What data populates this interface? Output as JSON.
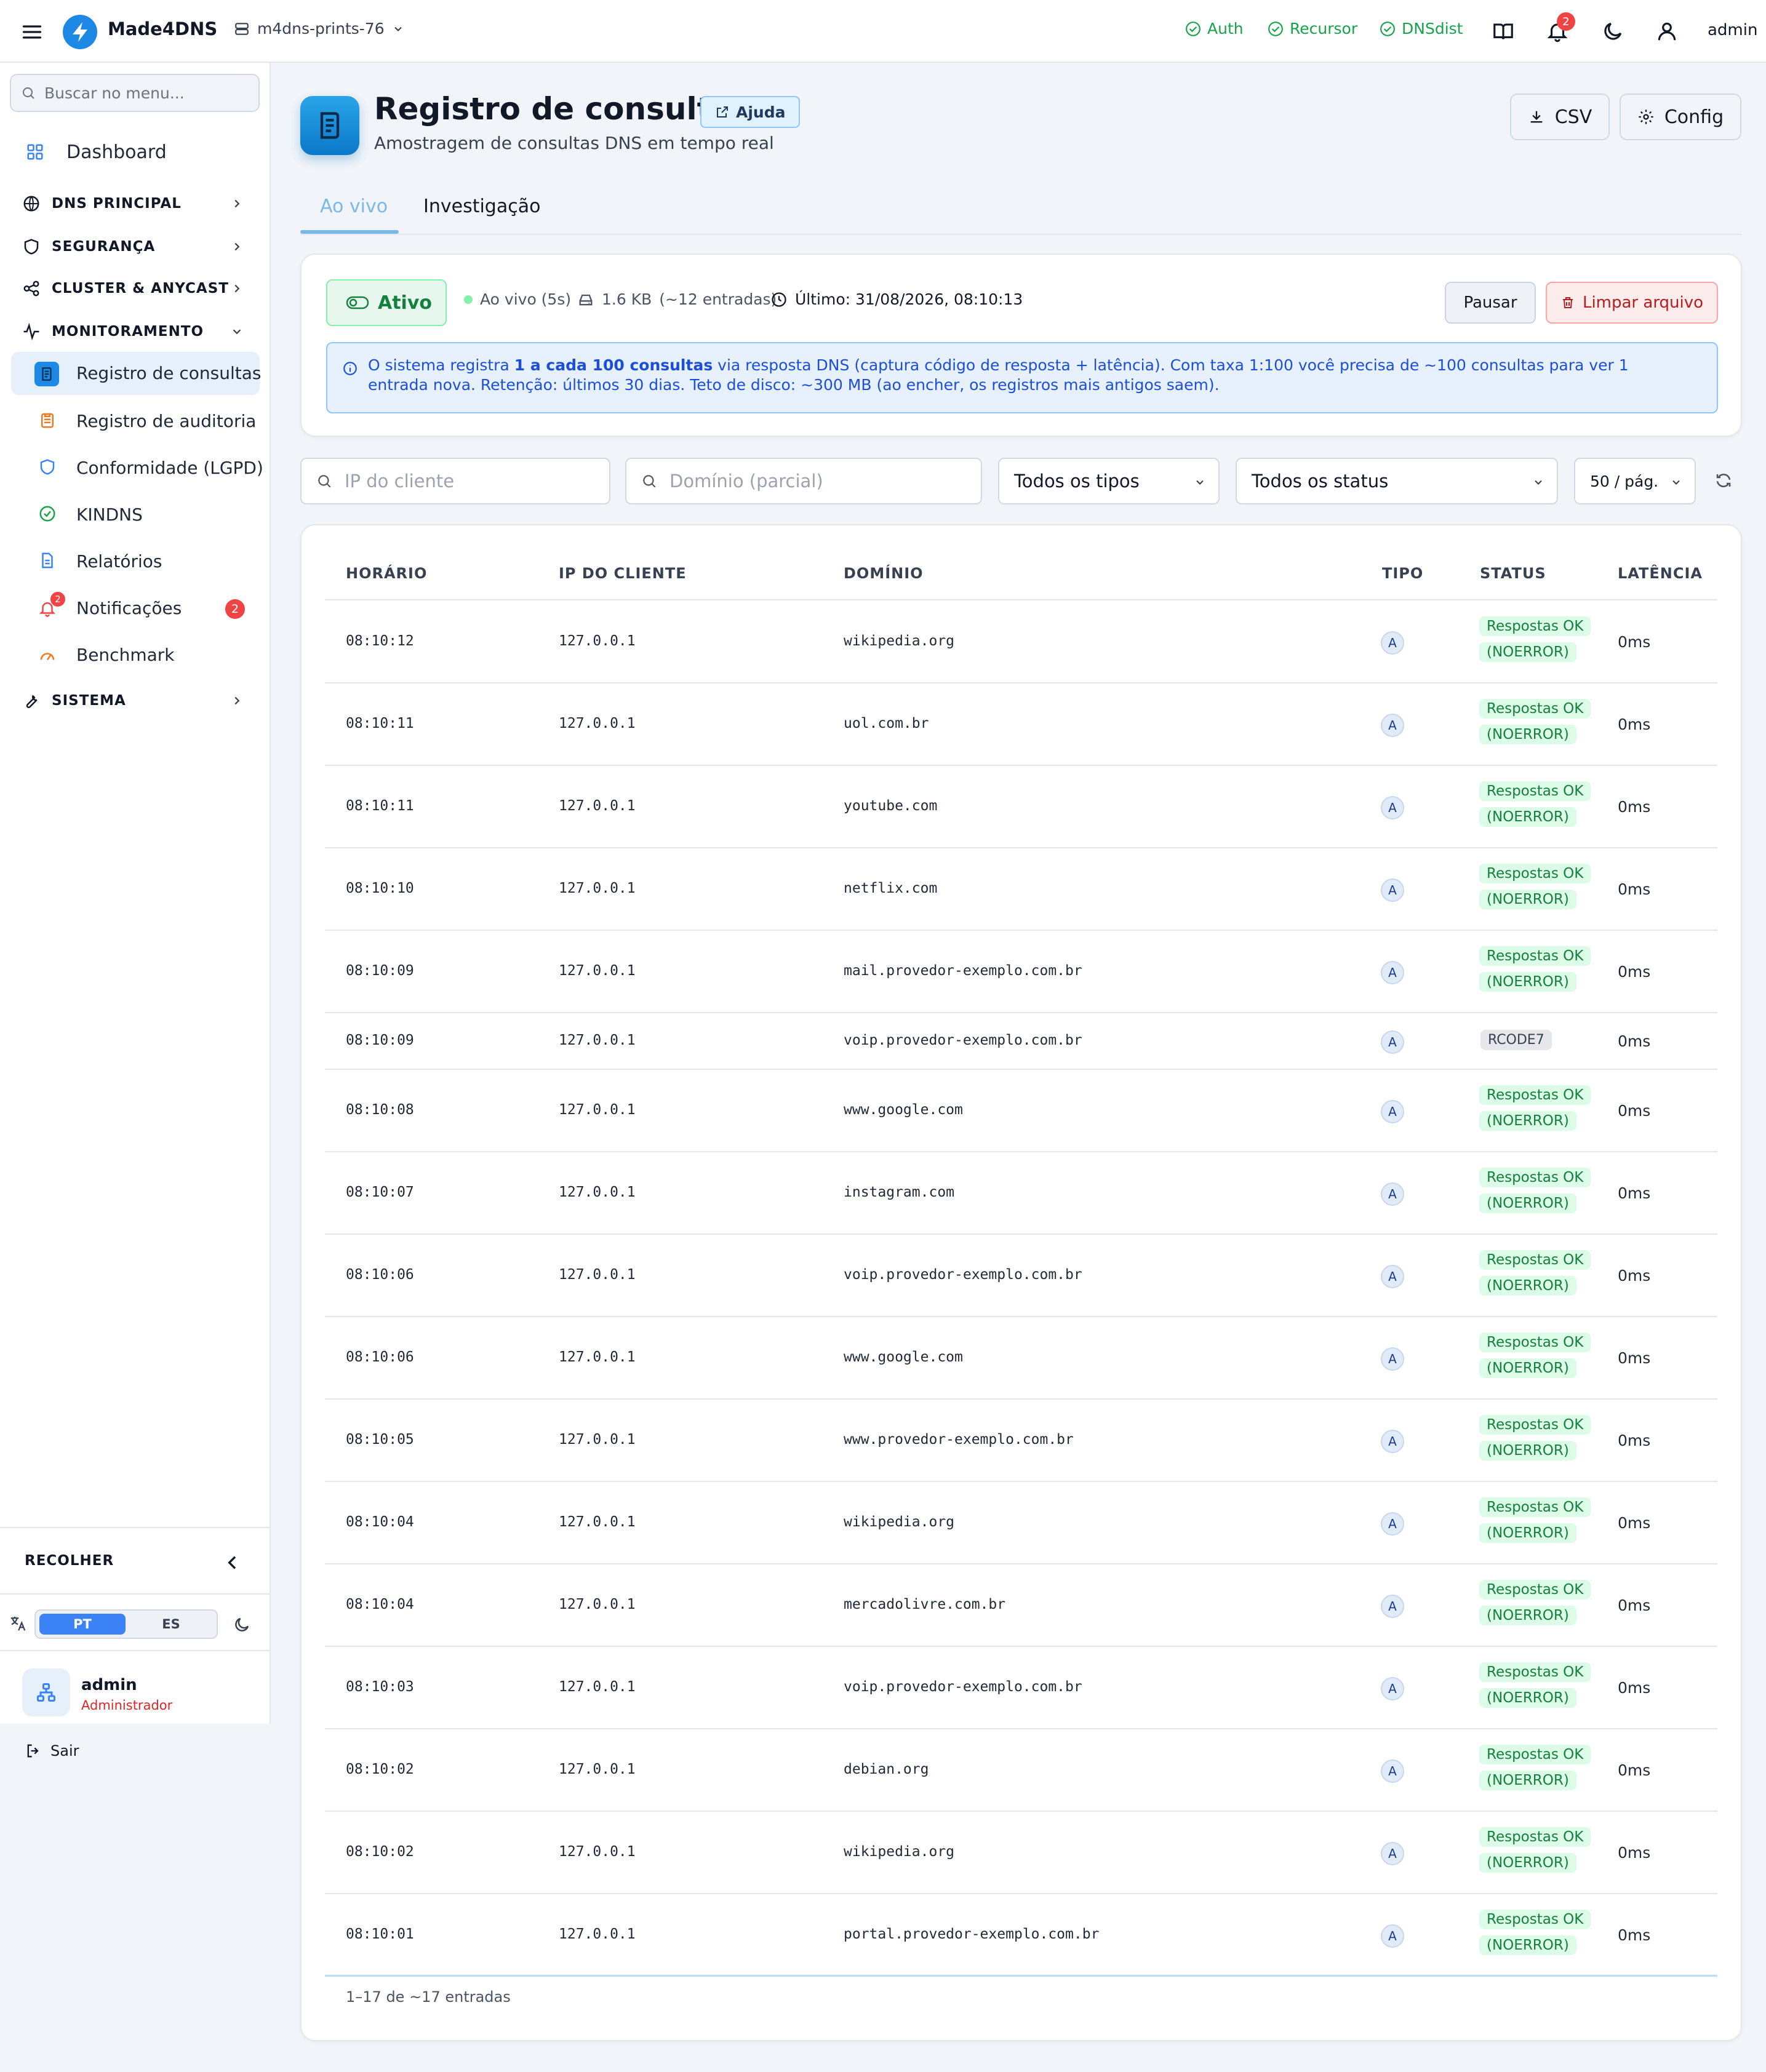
{
  "topbar": {
    "brand": "Made4DNS",
    "server": "m4dns-prints-76",
    "services": [
      "Auth",
      "Recursor",
      "DNSdist"
    ],
    "notifications_count": "2",
    "user": "admin"
  },
  "sidebar": {
    "search_placeholder": "Buscar no menu...",
    "dashboard": "Dashboard",
    "sections": {
      "dns": "DNS PRINCIPAL",
      "security": "SEGURANÇA",
      "cluster": "CLUSTER & ANYCAST",
      "monitoring": "MONITORAMENTO",
      "system": "SISTEMA"
    },
    "items": [
      {
        "label": "Registro de consultas",
        "icon": "query-log-icon"
      },
      {
        "label": "Registro de auditoria",
        "icon": "clipboard-icon"
      },
      {
        "label": "Conformidade (LGPD)",
        "icon": "shield-icon"
      },
      {
        "label": "KINDNS",
        "icon": "check-circle-icon"
      },
      {
        "label": "Relatórios",
        "icon": "document-icon"
      },
      {
        "label": "Notificações",
        "icon": "bell-icon",
        "badge": "2"
      },
      {
        "label": "Benchmark",
        "icon": "gauge-icon"
      }
    ],
    "collapse": "RECOLHER",
    "lang_pt": "PT",
    "lang_es": "ES",
    "user_name": "admin",
    "user_role": "Administrador",
    "logout": "Sair"
  },
  "header": {
    "title": "Registro de consultas",
    "help": "Ajuda",
    "subtitle": "Amostragem de consultas DNS em tempo real",
    "csv": "CSV",
    "config": "Config"
  },
  "tabs": [
    "Ao vivo",
    "Investigação"
  ],
  "status": {
    "state": "Ativo",
    "live": "Ao vivo (5s)",
    "size": "1.6 KB",
    "entries": "(~12 entradas)",
    "last": "Último: 31/08/2026, 08:10:13",
    "pause": "Pausar",
    "clear": "Limpar arquivo",
    "info_pre": "O sistema registra ",
    "info_bold": "1 a cada 100 consultas",
    "info_post": " via resposta DNS (captura código de resposta + latência). Com taxa 1:100 você precisa de ~100 consultas para ver 1 entrada nova. Retenção: últimos 30 dias. Teto de disco: ~300 MB (ao encher, os registros mais antigos saem)."
  },
  "filters": {
    "ip_placeholder": "IP do cliente",
    "domain_placeholder": "Domínio (parcial)",
    "type": "Todos os tipos",
    "status": "Todos os status",
    "per_page": "50 / pág."
  },
  "table": {
    "columns": [
      "HORÁRIO",
      "IP DO CLIENTE",
      "DOMÍNIO",
      "TIPO",
      "STATUS",
      "LATÊNCIA"
    ],
    "rows": [
      {
        "time": "08:10:12",
        "ip": "127.0.0.1",
        "domain": "wikipedia.org",
        "type": "A",
        "status1": "Respostas OK",
        "status2": "(NOERROR)",
        "latency": "0ms"
      },
      {
        "time": "08:10:11",
        "ip": "127.0.0.1",
        "domain": "uol.com.br",
        "type": "A",
        "status1": "Respostas OK",
        "status2": "(NOERROR)",
        "latency": "0ms"
      },
      {
        "time": "08:10:11",
        "ip": "127.0.0.1",
        "domain": "youtube.com",
        "type": "A",
        "status1": "Respostas OK",
        "status2": "(NOERROR)",
        "latency": "0ms"
      },
      {
        "time": "08:10:10",
        "ip": "127.0.0.1",
        "domain": "netflix.com",
        "type": "A",
        "status1": "Respostas OK",
        "status2": "(NOERROR)",
        "latency": "0ms"
      },
      {
        "time": "08:10:09",
        "ip": "127.0.0.1",
        "domain": "mail.provedor-exemplo.com.br",
        "type": "A",
        "status1": "Respostas OK",
        "status2": "(NOERROR)",
        "latency": "0ms"
      },
      {
        "time": "08:10:09",
        "ip": "127.0.0.1",
        "domain": "voip.provedor-exemplo.com.br",
        "type": "A",
        "status1": "RCODE7",
        "status2": "",
        "latency": "0ms"
      },
      {
        "time": "08:10:08",
        "ip": "127.0.0.1",
        "domain": "www.google.com",
        "type": "A",
        "status1": "Respostas OK",
        "status2": "(NOERROR)",
        "latency": "0ms"
      },
      {
        "time": "08:10:07",
        "ip": "127.0.0.1",
        "domain": "instagram.com",
        "type": "A",
        "status1": "Respostas OK",
        "status2": "(NOERROR)",
        "latency": "0ms"
      },
      {
        "time": "08:10:06",
        "ip": "127.0.0.1",
        "domain": "voip.provedor-exemplo.com.br",
        "type": "A",
        "status1": "Respostas OK",
        "status2": "(NOERROR)",
        "latency": "0ms"
      },
      {
        "time": "08:10:06",
        "ip": "127.0.0.1",
        "domain": "www.google.com",
        "type": "A",
        "status1": "Respostas OK",
        "status2": "(NOERROR)",
        "latency": "0ms"
      },
      {
        "time": "08:10:05",
        "ip": "127.0.0.1",
        "domain": "www.provedor-exemplo.com.br",
        "type": "A",
        "status1": "Respostas OK",
        "status2": "(NOERROR)",
        "latency": "0ms"
      },
      {
        "time": "08:10:04",
        "ip": "127.0.0.1",
        "domain": "wikipedia.org",
        "type": "A",
        "status1": "Respostas OK",
        "status2": "(NOERROR)",
        "latency": "0ms"
      },
      {
        "time": "08:10:04",
        "ip": "127.0.0.1",
        "domain": "mercadolivre.com.br",
        "type": "A",
        "status1": "Respostas OK",
        "status2": "(NOERROR)",
        "latency": "0ms"
      },
      {
        "time": "08:10:03",
        "ip": "127.0.0.1",
        "domain": "voip.provedor-exemplo.com.br",
        "type": "A",
        "status1": "Respostas OK",
        "status2": "(NOERROR)",
        "latency": "0ms"
      },
      {
        "time": "08:10:02",
        "ip": "127.0.0.1",
        "domain": "debian.org",
        "type": "A",
        "status1": "Respostas OK",
        "status2": "(NOERROR)",
        "latency": "0ms"
      },
      {
        "time": "08:10:02",
        "ip": "127.0.0.1",
        "domain": "wikipedia.org",
        "type": "A",
        "status1": "Respostas OK",
        "status2": "(NOERROR)",
        "latency": "0ms"
      },
      {
        "time": "08:10:01",
        "ip": "127.0.0.1",
        "domain": "portal.provedor-exemplo.com.br",
        "type": "A",
        "status1": "Respostas OK",
        "status2": "(NOERROR)",
        "latency": "0ms"
      }
    ],
    "footer": "1–17 de ~17 entradas"
  }
}
